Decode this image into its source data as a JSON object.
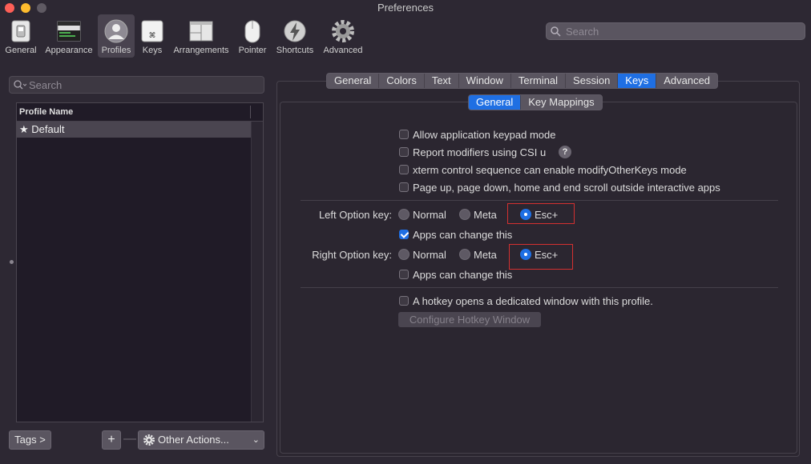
{
  "window": {
    "title": "Preferences"
  },
  "toolbar": {
    "items": [
      {
        "label": "General",
        "icon": "switch-icon"
      },
      {
        "label": "Appearance",
        "icon": "terminal-window-icon"
      },
      {
        "label": "Profiles",
        "icon": "person-icon"
      },
      {
        "label": "Keys",
        "icon": "command-key-icon"
      },
      {
        "label": "Arrangements",
        "icon": "window-arrangement-icon"
      },
      {
        "label": "Pointer",
        "icon": "mouse-icon"
      },
      {
        "label": "Shortcuts",
        "icon": "lightning-icon"
      },
      {
        "label": "Advanced",
        "icon": "gear-icon"
      }
    ],
    "selected": "Profiles"
  },
  "search": {
    "placeholder": "Search"
  },
  "profiles": {
    "search_placeholder": "Search",
    "column_header": "Profile Name",
    "rows": [
      {
        "name": "Default",
        "star": "★"
      }
    ],
    "tags_label": "Tags >",
    "add_label": "+",
    "remove_label": "—",
    "other_actions_label": "Other Actions...",
    "chevron": "⌄"
  },
  "tabs": {
    "main": [
      "General",
      "Colors",
      "Text",
      "Window",
      "Terminal",
      "Session",
      "Keys",
      "Advanced"
    ],
    "main_active": "Keys",
    "sub": [
      "General",
      "Key Mappings"
    ],
    "sub_active": "General"
  },
  "keys": {
    "checkboxes": [
      {
        "label": "Allow application keypad mode",
        "checked": false
      },
      {
        "label": "Report modifiers using CSI u",
        "checked": false,
        "help": "?"
      },
      {
        "label": "xterm control sequence can enable modifyOtherKeys mode",
        "checked": false
      },
      {
        "label": "Page up, page down, home and end scroll outside interactive apps",
        "checked": false
      }
    ],
    "left_option": {
      "label": "Left Option key:",
      "options": [
        "Normal",
        "Meta",
        "Esc+"
      ],
      "selected": "Esc+",
      "apps_can_change": {
        "label": "Apps can change this",
        "checked": true
      }
    },
    "right_option": {
      "label": "Right Option key:",
      "options": [
        "Normal",
        "Meta",
        "Esc+"
      ],
      "selected": "Esc+",
      "apps_can_change": {
        "label": "Apps can change this",
        "checked": false
      }
    },
    "hotkey": {
      "label": "A hotkey opens a dedicated window with this profile.",
      "checked": false
    },
    "configure_hotkey_label": "Configure Hotkey Window"
  },
  "colors": {
    "accent": "#1f6fe3",
    "highlight_box": "#d43030",
    "background": "#2d2833"
  }
}
